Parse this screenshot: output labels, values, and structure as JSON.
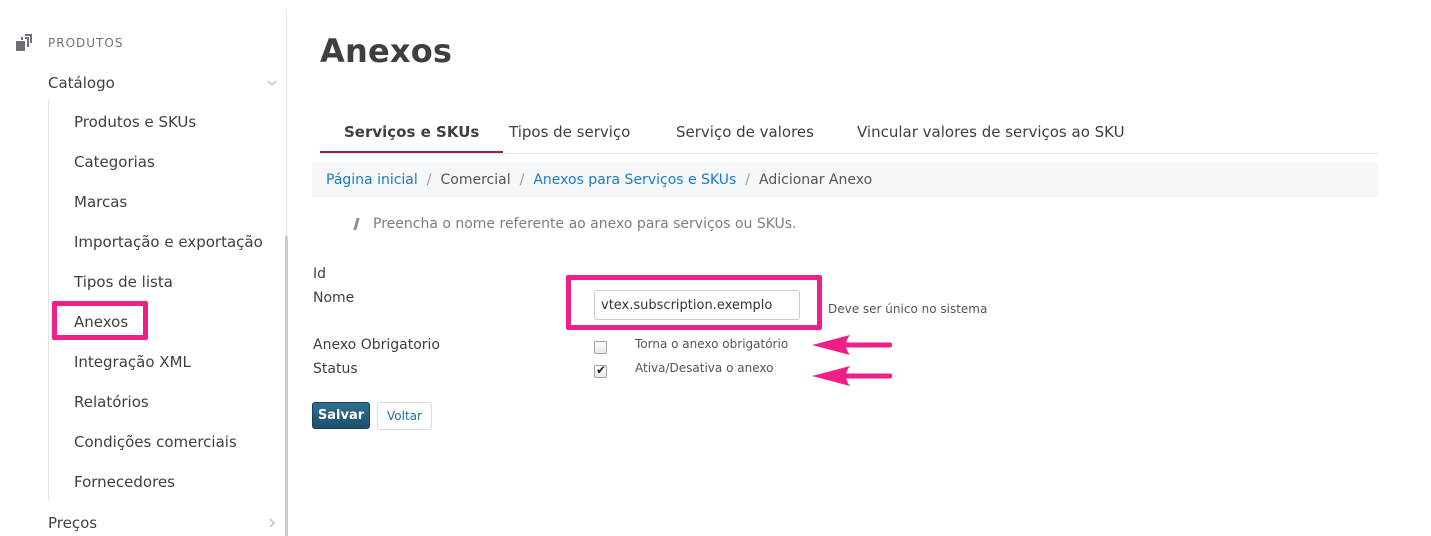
{
  "sidebar": {
    "section_label": "PRODUTOS",
    "section_icon": "products-icon",
    "catalog_label": "Catálogo",
    "items": [
      {
        "label": "Produtos e SKUs"
      },
      {
        "label": "Categorias"
      },
      {
        "label": "Marcas"
      },
      {
        "label": "Importação e exportação"
      },
      {
        "label": "Tipos de lista"
      },
      {
        "label": "Anexos"
      },
      {
        "label": "Integração XML"
      },
      {
        "label": "Relatórios"
      },
      {
        "label": "Condições comerciais"
      },
      {
        "label": "Fornecedores"
      }
    ],
    "precos_label": "Preços"
  },
  "page": {
    "title": "Anexos"
  },
  "tabs": [
    {
      "label": "Serviços e SKUs",
      "active": true
    },
    {
      "label": "Tipos de serviço",
      "active": false
    },
    {
      "label": "Serviço de valores",
      "active": false
    },
    {
      "label": "Vincular valores de serviços ao SKU",
      "active": false
    }
  ],
  "breadcrumb": {
    "home": "Página inicial",
    "commercial": "Comercial",
    "annexes": "Anexos para Serviços e SKUs",
    "current": "Adicionar Anexo"
  },
  "help_text": "Preencha o nome referente ao anexo para serviços ou SKUs.",
  "form": {
    "id_label": "Id",
    "name_label": "Nome",
    "name_value": "vtex.subscription.exemplo",
    "name_hint": "Deve ser único no sistema",
    "required_label": "Anexo Obrigatorio",
    "required_checked": false,
    "required_hint": "Torna o anexo obrigatório",
    "status_label": "Status",
    "status_checked": true,
    "status_hint": "Ativa/Desativa o anexo",
    "save_label": "Salvar",
    "back_label": "Voltar"
  },
  "colors": {
    "highlight": "#ef1f8a",
    "active_tab": "#8b2252",
    "link": "#1a7cc7",
    "save_button": "#1d4f6d"
  }
}
